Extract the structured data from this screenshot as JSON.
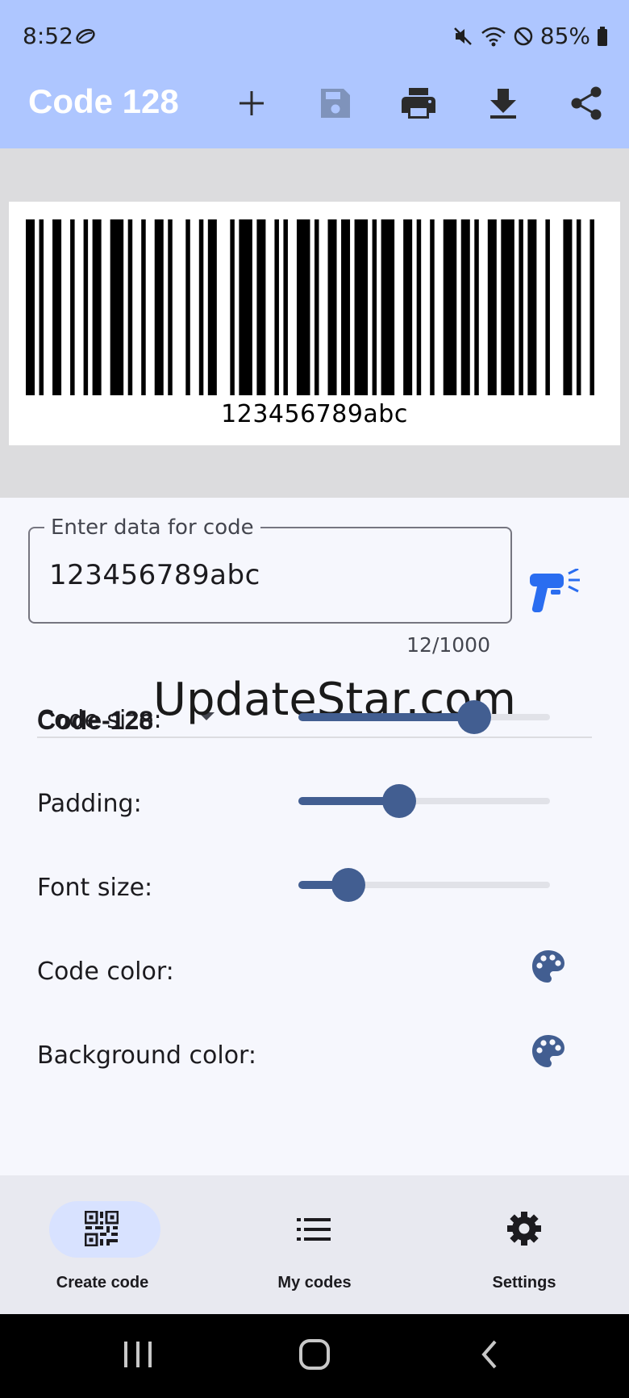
{
  "status_bar": {
    "time": "8:52",
    "battery": "85%",
    "icons": [
      "lens-icon",
      "mute-icon",
      "wifi-icon",
      "do-not-disturb-icon",
      "battery-icon"
    ]
  },
  "app_bar": {
    "title": "Code 128",
    "actions": [
      "add-icon",
      "save-icon",
      "print-icon",
      "download-icon",
      "share-icon"
    ]
  },
  "preview": {
    "barcode_text": "123456789abc"
  },
  "form": {
    "data_field_label": "Enter data for code",
    "data_field_value": "123456789abc",
    "char_counter": "12/1000",
    "code_type": "Code-128",
    "watermark": "UpdateStar.com",
    "settings": [
      {
        "label": "Code size:",
        "kind": "slider",
        "value": 0.7
      },
      {
        "label": "Padding:",
        "kind": "slider",
        "value": 0.4
      },
      {
        "label": "Font size:",
        "kind": "slider",
        "value": 0.2
      },
      {
        "label": "Code color:",
        "kind": "palette"
      },
      {
        "label": "Background color:",
        "kind": "palette"
      }
    ]
  },
  "bottom_nav": {
    "items": [
      {
        "label": "Create code",
        "icon": "qr-code-icon",
        "active": true
      },
      {
        "label": "My codes",
        "icon": "list-icon",
        "active": false
      },
      {
        "label": "Settings",
        "icon": "gear-icon",
        "active": false
      }
    ]
  },
  "colors": {
    "app_bar": "#aec6ff",
    "accent": "#425e91",
    "scanner": "#2a6df0",
    "nav_active_pill": "#d8e2ff"
  }
}
